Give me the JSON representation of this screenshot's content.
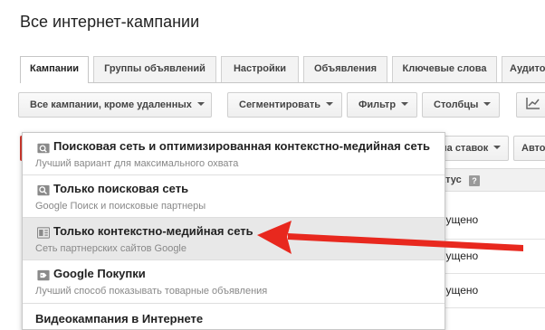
{
  "page": {
    "title": "Все интернет-кампании"
  },
  "tabs": [
    {
      "label": "Кампании",
      "active": true
    },
    {
      "label": "Группы объявлений"
    },
    {
      "label": "Настройки"
    },
    {
      "label": "Объявления"
    },
    {
      "label": "Ключевые слова"
    },
    {
      "label": "Аудитор"
    }
  ],
  "toolbar": {
    "campaigns_filter": "Все кампании, кроме удаленных",
    "segment": "Сегментировать",
    "filter": "Фильтр",
    "columns": "Столбцы"
  },
  "secondary_toolbar": {
    "bid_button": "на ставок",
    "auto_button": "Авто"
  },
  "table": {
    "status_header": "атус",
    "help": "?",
    "rows": [
      "пущено",
      "пущено",
      "пущено"
    ]
  },
  "dropdown": {
    "options": [
      {
        "title": "Поисковая сеть и оптимизированная контекстно-медийная сеть",
        "subtitle": "Лучший вариант для максимального охвата",
        "icon": "search-display-icon"
      },
      {
        "title": "Только поисковая сеть",
        "subtitle": "Google Поиск и поисковые партнеры",
        "icon": "search-icon"
      },
      {
        "title": "Только контекстно-медийная сеть",
        "subtitle": "Сеть партнерских сайтов Google",
        "icon": "display-network-icon",
        "highlighted": true
      },
      {
        "title": "Google Покупки",
        "subtitle": "Лучший способ показывать товарные объявления",
        "icon": "shopping-tag-icon"
      }
    ],
    "video_option": "Видеокампания в Интернете"
  },
  "annotation": {
    "arrow_color": "#e8281e"
  },
  "colors": {
    "highlight": "#e8e8e8",
    "accent_red": "#d63a2f"
  }
}
